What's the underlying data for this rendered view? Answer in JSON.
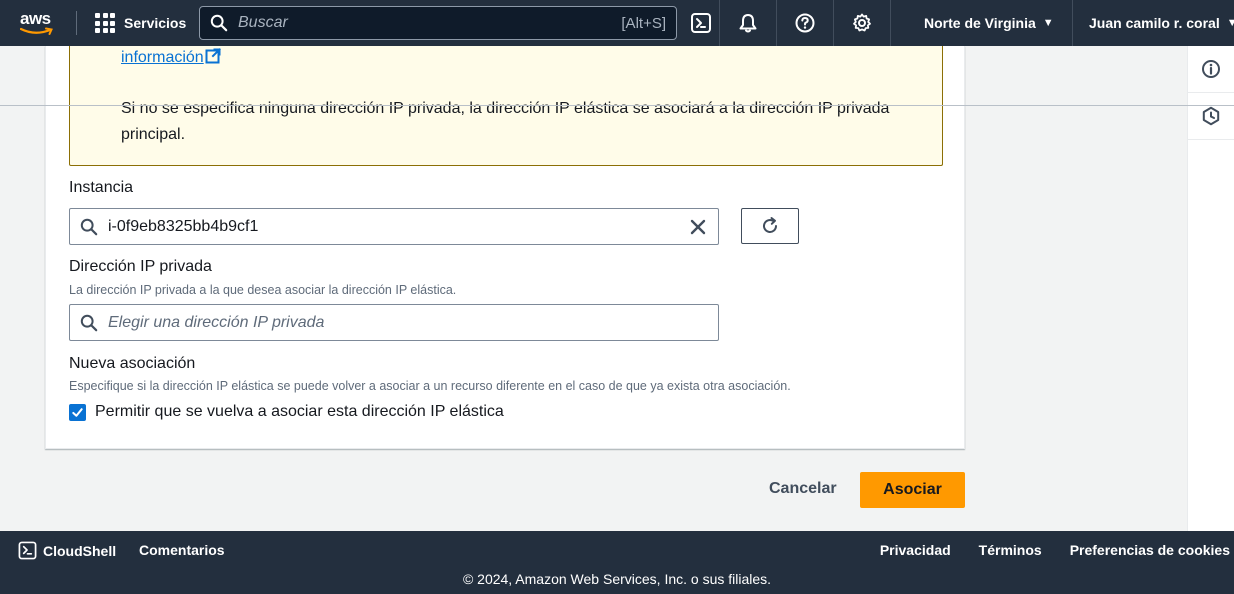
{
  "topnav": {
    "logo_text": "aws",
    "services_label": "Servicios",
    "search_placeholder": "Buscar",
    "search_shortcut": "[Alt+S]",
    "icons": [
      "cloudshell-icon",
      "bell-icon",
      "help-icon",
      "settings-icon"
    ],
    "region": "Norte de Virginia",
    "user": "Juan camilo r. coral"
  },
  "alert": {
    "link_text": "información",
    "text": "Si no se especifica ninguna dirección IP privada, la dirección IP elástica se asociará a la dirección IP privada principal."
  },
  "form": {
    "instance": {
      "label": "Instancia",
      "value": "i-0f9eb8325bb4b9cf1"
    },
    "private_ip": {
      "label": "Dirección IP privada",
      "description": "La dirección IP privada a la que desea asociar la dirección IP elástica.",
      "placeholder": "Elegir una dirección IP privada"
    },
    "reassociation": {
      "label": "Nueva asociación",
      "description": "Especifique si la dirección IP elástica se puede volver a asociar a un recurso diferente en el caso de que ya exista otra asociación.",
      "checkbox_label": "Permitir que se vuelva a asociar esta dirección IP elástica",
      "checked": true
    }
  },
  "actions": {
    "cancel": "Cancelar",
    "submit": "Asociar"
  },
  "footer": {
    "cloudshell": "CloudShell",
    "feedback": "Comentarios",
    "privacy": "Privacidad",
    "terms": "Términos",
    "cookies": "Preferencias de cookies",
    "copyright": "© 2024, Amazon Web Services, Inc. o sus filiales."
  },
  "colors": {
    "nav_bg": "#232f3e",
    "primary": "#ff9900",
    "link": "#0972d3",
    "alert_bg": "#fffce9",
    "alert_border": "#8c6f05"
  }
}
